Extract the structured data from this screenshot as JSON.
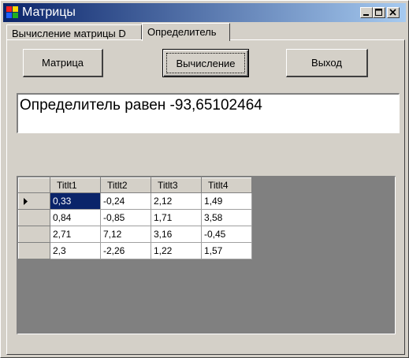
{
  "window": {
    "title": "Матрицы"
  },
  "tabs": [
    {
      "label": "Вычисление матрицы D"
    },
    {
      "label": "Определитель"
    }
  ],
  "buttons": {
    "matrix": "Матрица",
    "compute": "Вычисление",
    "exit": "Выход"
  },
  "result": {
    "text": "Определитель равен  -93,65102464"
  },
  "grid": {
    "columns": [
      "Titlt1",
      "Titlt2",
      "Titlt3",
      "Titlt4"
    ],
    "rows": [
      [
        "0,33",
        "-0,24",
        "2,12",
        "1,49"
      ],
      [
        "0,84",
        "-0,85",
        "1,71",
        "3,58"
      ],
      [
        "2,71",
        "7,12",
        "3,16",
        "-0,45"
      ],
      [
        "2,3",
        "-2,26",
        "1,22",
        "1,57"
      ]
    ],
    "selected_cell": "0,33"
  },
  "colors": {
    "titlebar_start": "#0a246a",
    "titlebar_end": "#a6caf0",
    "face": "#d4d0c8",
    "selection": "#0a246a"
  }
}
